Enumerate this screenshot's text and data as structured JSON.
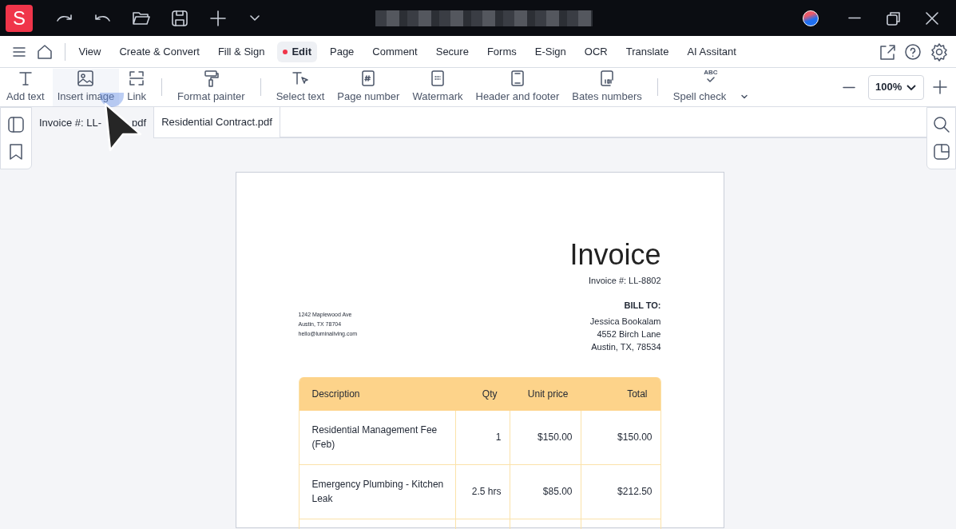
{
  "app": {
    "logo": "S"
  },
  "menu": [
    {
      "label": "View",
      "selected": false
    },
    {
      "label": "Create & Convert",
      "selected": false
    },
    {
      "label": "Fill & Sign",
      "selected": false
    },
    {
      "label": "Edit",
      "selected": true
    },
    {
      "label": "Page",
      "selected": false
    },
    {
      "label": "Comment",
      "selected": false
    },
    {
      "label": "Secure",
      "selected": false
    },
    {
      "label": "Forms",
      "selected": false
    },
    {
      "label": "E-Sign",
      "selected": false
    },
    {
      "label": "OCR",
      "selected": false
    },
    {
      "label": "Translate",
      "selected": false
    },
    {
      "label": "AI Assitant",
      "selected": false
    }
  ],
  "toolbar": [
    {
      "kind": "text",
      "label": "Add text"
    },
    {
      "kind": "image",
      "label": "Insert image"
    },
    {
      "kind": "link",
      "label": "Link"
    },
    {
      "kind": "sep"
    },
    {
      "kind": "painter",
      "label": "Format painter"
    },
    {
      "kind": "sep"
    },
    {
      "kind": "select",
      "label": "Select text"
    },
    {
      "kind": "pagenum",
      "label": "Page number"
    },
    {
      "kind": "watermark",
      "label": "Watermark"
    },
    {
      "kind": "header",
      "label": "Header and footer"
    },
    {
      "kind": "bates",
      "label": "Bates numbers"
    },
    {
      "kind": "sep"
    },
    {
      "kind": "spell",
      "label": "Spell check",
      "icon_text": "ABC"
    }
  ],
  "zoom": {
    "value": "100%"
  },
  "doc_tabs": [
    {
      "label": "Invoice #: LL-",
      "label_end": "pdf",
      "selected": true
    },
    {
      "label": "Residential Contract.pdf",
      "selected": false
    }
  ],
  "invoice": {
    "title": "Invoice",
    "number": "Invoice #: LL-8802",
    "sender": [
      "1242 Maplewood Ave",
      "Austin, TX 78704",
      "hello@luminaliving.com"
    ],
    "bill_to_label": "BILL TO:",
    "bill_to": [
      "Jessica Bookalam",
      "4552 Birch Lane",
      "Austin, TX, 78534"
    ],
    "columns": [
      "Description",
      "Qty",
      "Unit price",
      "Total"
    ],
    "rows": [
      [
        "Residential Management Fee (Feb)",
        "1",
        "$150.00",
        "$150.00"
      ],
      [
        "Emergency Plumbing - Kitchen Leak",
        "2.5 hrs",
        "$85.00",
        "$212.50"
      ]
    ]
  }
}
